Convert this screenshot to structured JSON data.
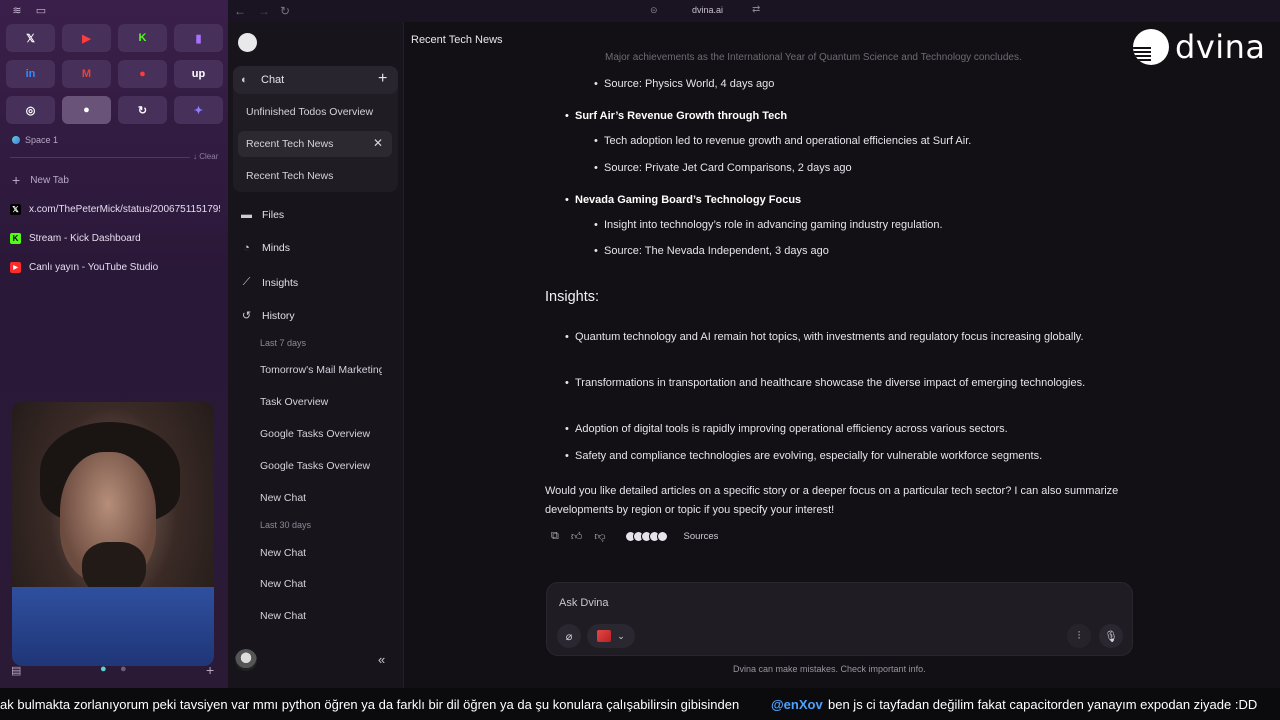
{
  "browser": {
    "url": "dvina.ai",
    "pinned_tabs": [
      {
        "icon": "x-icon",
        "glyph": "𝕏",
        "color": "#ffffff"
      },
      {
        "icon": "youtube-icon",
        "glyph": "▶",
        "color": "#ff3b3b"
      },
      {
        "icon": "kick-icon",
        "glyph": "K",
        "color": "#53fc18"
      },
      {
        "icon": "twitch-icon",
        "glyph": "▮",
        "color": "#a970ff"
      },
      {
        "icon": "linkedin-icon",
        "glyph": "in",
        "color": "#2f8cff"
      },
      {
        "icon": "gmail-icon",
        "glyph": "M",
        "color": "#ea4335"
      },
      {
        "icon": "youtube-studio-icon",
        "glyph": "●",
        "color": "#ff3b3b"
      },
      {
        "icon": "upwork-icon",
        "glyph": "up",
        "color": "#ffffff"
      },
      {
        "icon": "globe-icon",
        "glyph": "◎",
        "color": "#ffffff"
      },
      {
        "icon": "dvina-icon",
        "glyph": "●",
        "color": "#ffffff"
      },
      {
        "icon": "sync-icon",
        "glyph": "↻",
        "color": "#ffffff"
      },
      {
        "icon": "gemini-icon",
        "glyph": "✦",
        "color": "#8a7dff"
      }
    ],
    "space_label": "Space 1",
    "clear_label": "Clear",
    "new_tab_label": "New Tab",
    "tabs": [
      {
        "label": "x.com/ThePeterMick/status/2006751151795...",
        "icon": "x-icon",
        "glyph": "𝕏",
        "color": "#ffffff",
        "bg": "#000000"
      },
      {
        "label": "Stream - Kick Dashboard",
        "icon": "kick-icon",
        "glyph": "K",
        "color": "#000000",
        "bg": "#53fc18"
      },
      {
        "label": "Canlı yayın - YouTube Studio",
        "icon": "youtube-icon",
        "glyph": "▶",
        "color": "#ffffff",
        "bg": "#ff2a2a"
      }
    ]
  },
  "app": {
    "page_title": "Recent Tech News",
    "brand_name": "dvina",
    "sidebar": {
      "chat_label": "Chat",
      "chat_items": [
        {
          "label": "Unfinished Todos Overview"
        },
        {
          "label": "Recent Tech News"
        },
        {
          "label": "Recent Tech News"
        }
      ],
      "nav": [
        {
          "label": "Files",
          "icon": "folder-icon"
        },
        {
          "label": "Minds",
          "icon": "flame-icon"
        },
        {
          "label": "Insights",
          "icon": "chart-icon"
        },
        {
          "label": "History",
          "icon": "history-icon"
        }
      ],
      "history_last7_label": "Last 7 days",
      "history_last7": [
        "Tomorrow's Mail Marketing",
        "Task Overview",
        "Google Tasks Overview",
        "Google Tasks Overview",
        "New Chat"
      ],
      "history_last30_label": "Last 30 days",
      "history_last30": [
        "New Chat",
        "New Chat",
        "New Chat"
      ]
    },
    "message": {
      "faded_line": "Major achievements as the International Year of Quantum Science and Technology concludes.",
      "top_source": "Source: Physics World, 4 days ago",
      "stories": [
        {
          "title": "Surf Air’s Revenue Growth through Tech",
          "detail": "Tech adoption led to revenue growth and operational efficiencies at Surf Air.",
          "source": "Source: Private Jet Card Comparisons, 2 days ago"
        },
        {
          "title": "Nevada Gaming Board’s Technology Focus",
          "detail": "Insight into technology’s role in advancing gaming industry regulation.",
          "source": "Source: The Nevada Independent, 3 days ago"
        }
      ],
      "insights_heading": "Insights:",
      "insights": [
        "Quantum technology and AI remain hot topics, with investments and regulatory focus increasing globally.",
        "Transformations in transportation and healthcare showcase the diverse impact of emerging technologies.",
        "Adoption of digital tools is rapidly improving operational efficiency across various sectors.",
        "Safety and compliance technologies are evolving, especially for vulnerable workforce segments."
      ],
      "closing": "Would you like detailed articles on a specific story or a deeper focus on a particular tech sector? I can also summarize developments by region or topic if you specify your interest!",
      "sources_label": "Sources"
    },
    "composer": {
      "placeholder": "Ask Dvina",
      "disclaimer": "Dvina can make mistakes. Check important info."
    }
  },
  "ticker": {
    "text1": "ak bulmakta zorlanıyorum peki tavsiyen var mmı python öğren ya da farklı bir dil öğren ya da şu konulara çalışabilirsin gibisinden",
    "handle": "@enXov",
    "text2": "ben js ci tayfadan değilim fakat capacitorden yanayım expodan ziyade :DD"
  }
}
